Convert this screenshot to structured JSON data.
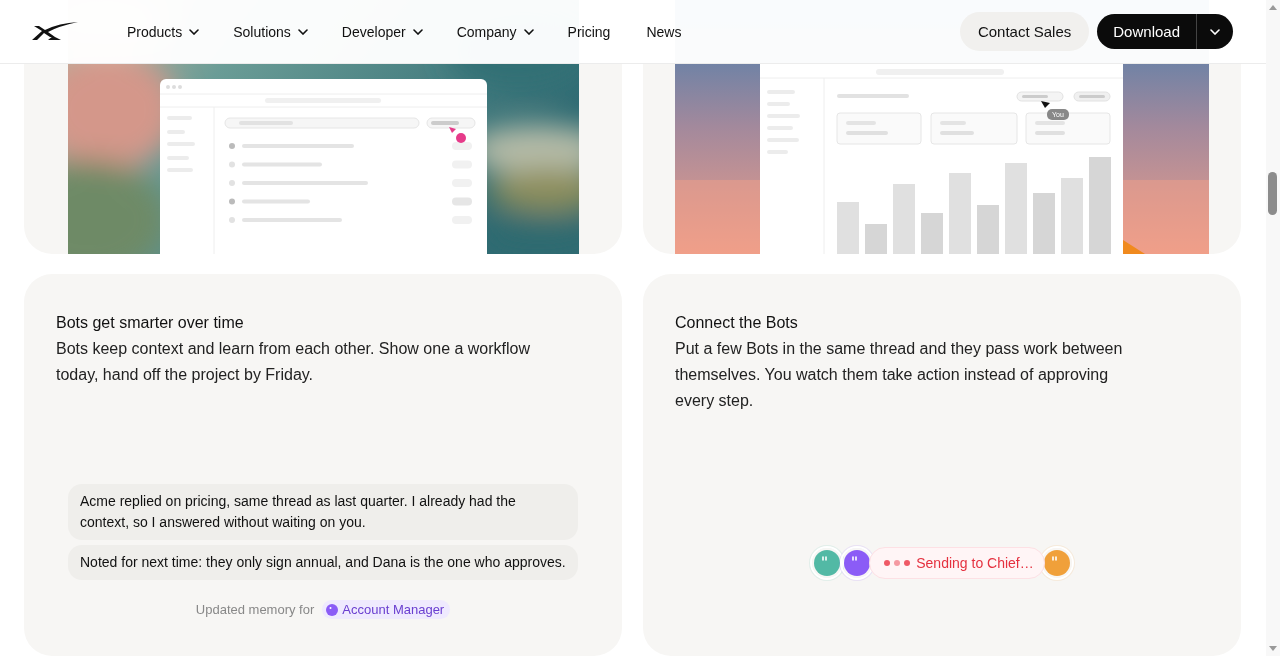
{
  "nav": {
    "items": [
      {
        "label": "Products",
        "has_menu": true
      },
      {
        "label": "Solutions",
        "has_menu": true
      },
      {
        "label": "Developer",
        "has_menu": true
      },
      {
        "label": "Company",
        "has_menu": true
      },
      {
        "label": "Pricing",
        "has_menu": false
      },
      {
        "label": "News",
        "has_menu": false
      }
    ],
    "contact": "Contact Sales",
    "download": "Download"
  },
  "showcases": [
    {
      "kind": "list-mockup"
    },
    {
      "kind": "chart-mockup",
      "cursor_label": "You"
    }
  ],
  "features": [
    {
      "kind": "chat",
      "title": "Bots get smarter over time",
      "body": "Bots keep context and learn from each other. Show one a workflow today, hand off the project by Friday.",
      "messages": [
        "Acme replied on pricing, same thread as last quarter. I already had the context, so I answered without waiting on you.",
        "Noted for next time: they only sign annual, and Dana is the one who approves."
      ],
      "note": "Updated memory for",
      "agent": {
        "name": "Account Manager",
        "color": "#8b5cf6"
      }
    },
    {
      "kind": "handoff",
      "title": "Connect the Bots",
      "body": "Put a few Bots in the same thread and they pass work between themselves. You watch them take action instead of approving every step.",
      "agents_before": [
        {
          "color": "#52b9a5"
        },
        {
          "color": "#8b5cf6"
        }
      ],
      "status": "Sending to Chief…",
      "agents_after": [
        {
          "color": "#f0a03a"
        }
      ]
    }
  ]
}
